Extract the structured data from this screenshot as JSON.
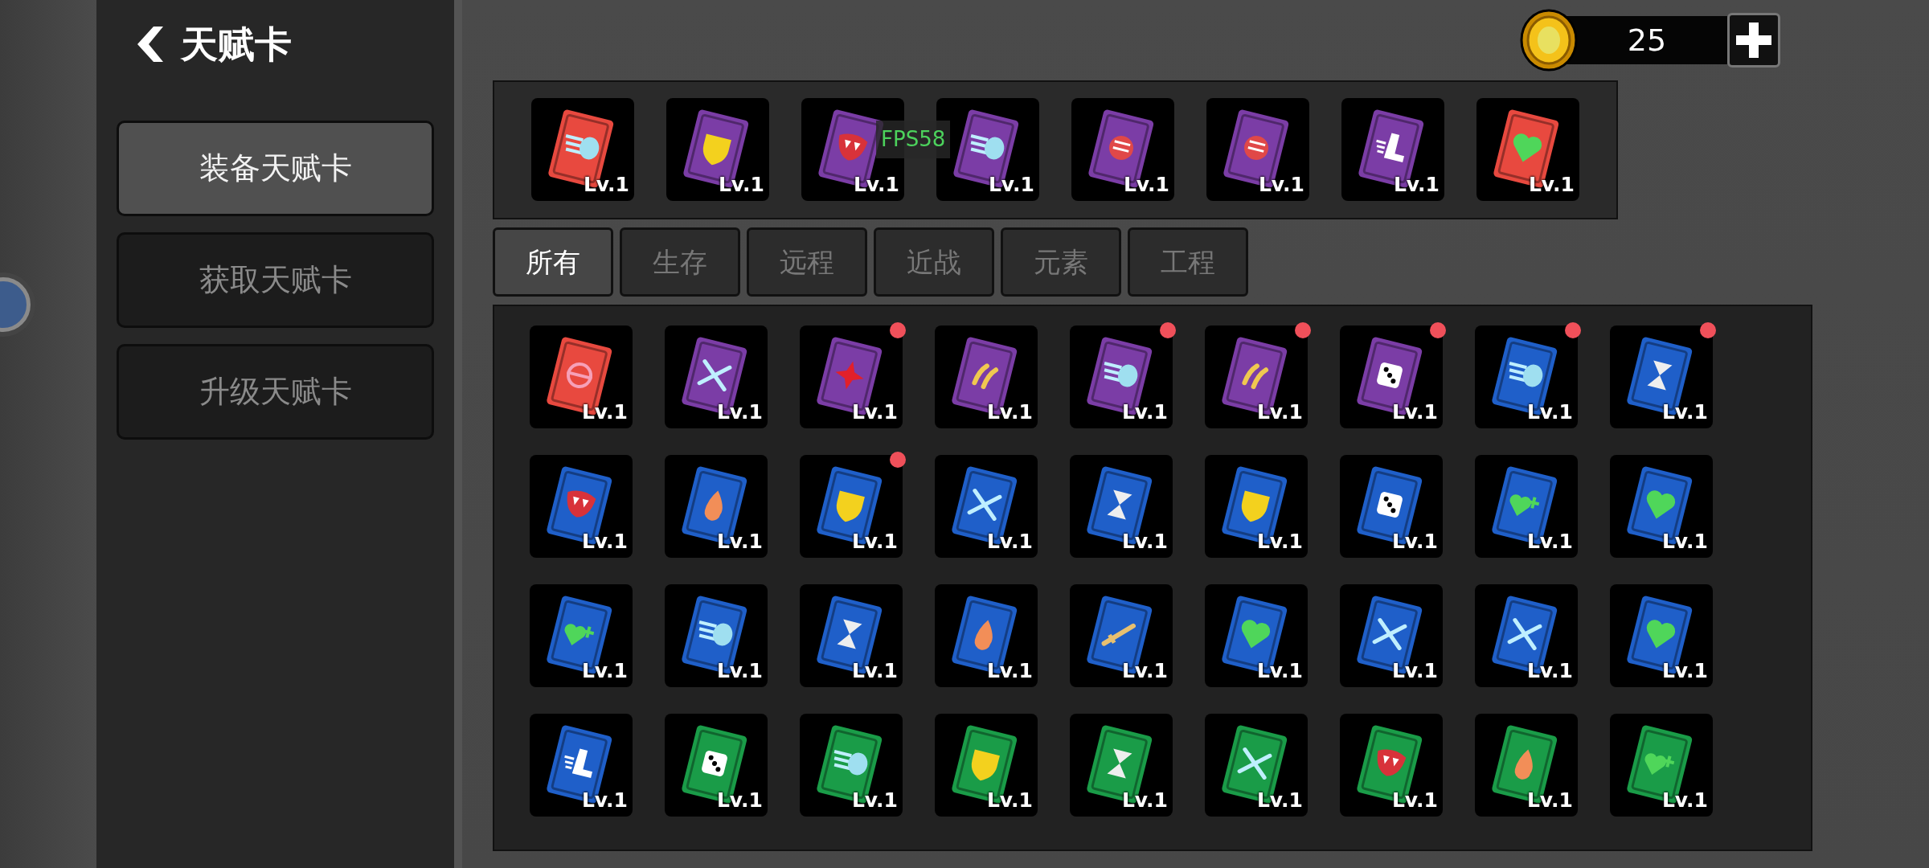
{
  "header": {
    "title": "天赋卡"
  },
  "menu": [
    {
      "label": "装备天赋卡",
      "selected": true
    },
    {
      "label": "获取天赋卡",
      "selected": false
    },
    {
      "label": "升级天赋卡",
      "selected": false
    }
  ],
  "coins": {
    "amount": "25"
  },
  "fps": "FPS58",
  "equipped": [
    {
      "color": "#e8493f",
      "kind": "wing",
      "level": "Lv.1"
    },
    {
      "color": "#7b3da6",
      "kind": "shield",
      "level": "Lv.1"
    },
    {
      "color": "#7b3da6",
      "kind": "fangs",
      "level": "Lv.1"
    },
    {
      "color": "#7b3da6",
      "kind": "wing",
      "level": "Lv.1"
    },
    {
      "color": "#7b3da6",
      "kind": "fist",
      "level": "Lv.1"
    },
    {
      "color": "#7b3da6",
      "kind": "fist",
      "level": "Lv.1"
    },
    {
      "color": "#7b3da6",
      "kind": "boot",
      "level": "Lv.1"
    },
    {
      "color": "#e8493f",
      "kind": "heart",
      "level": "Lv.1"
    }
  ],
  "tabs": [
    {
      "label": "所有",
      "selected": true
    },
    {
      "label": "生存",
      "selected": false
    },
    {
      "label": "远程",
      "selected": false
    },
    {
      "label": "近战",
      "selected": false
    },
    {
      "label": "元素",
      "selected": false
    },
    {
      "label": "工程",
      "selected": false
    }
  ],
  "cards": [
    {
      "color": "#e8493f",
      "kind": "bow",
      "level": "Lv.1",
      "notified": false
    },
    {
      "color": "#7b3da6",
      "kind": "wrench",
      "level": "Lv.1",
      "notified": false
    },
    {
      "color": "#7b3da6",
      "kind": "star",
      "level": "Lv.1",
      "notified": true
    },
    {
      "color": "#7b3da6",
      "kind": "wheat",
      "level": "Lv.1",
      "notified": false
    },
    {
      "color": "#7b3da6",
      "kind": "wing",
      "level": "Lv.1",
      "notified": true
    },
    {
      "color": "#7b3da6",
      "kind": "wheat",
      "level": "Lv.1",
      "notified": true
    },
    {
      "color": "#7b3da6",
      "kind": "dice",
      "level": "Lv.1",
      "notified": true
    },
    {
      "color": "#1f5fc9",
      "kind": "wing",
      "level": "Lv.1",
      "notified": true
    },
    {
      "color": "#1f5fc9",
      "kind": "hourglass",
      "level": "Lv.1",
      "notified": true
    },
    {
      "color": "#1f5fc9",
      "kind": "fangs",
      "level": "Lv.1",
      "notified": false
    },
    {
      "color": "#1f5fc9",
      "kind": "flame",
      "level": "Lv.1",
      "notified": false
    },
    {
      "color": "#1f5fc9",
      "kind": "shield",
      "level": "Lv.1",
      "notified": true
    },
    {
      "color": "#1f5fc9",
      "kind": "wrench",
      "level": "Lv.1",
      "notified": false
    },
    {
      "color": "#1f5fc9",
      "kind": "hourglass",
      "level": "Lv.1",
      "notified": false
    },
    {
      "color": "#1f5fc9",
      "kind": "shield",
      "level": "Lv.1",
      "notified": false
    },
    {
      "color": "#1f5fc9",
      "kind": "dice",
      "level": "Lv.1",
      "notified": false
    },
    {
      "color": "#1f5fc9",
      "kind": "heartplus",
      "level": "Lv.1",
      "notified": false
    },
    {
      "color": "#1f5fc9",
      "kind": "heart",
      "level": "Lv.1",
      "notified": false
    },
    {
      "color": "#1f5fc9",
      "kind": "heartplus",
      "level": "Lv.1",
      "notified": false
    },
    {
      "color": "#1f5fc9",
      "kind": "wing",
      "level": "Lv.1",
      "notified": false
    },
    {
      "color": "#1f5fc9",
      "kind": "hourglass",
      "level": "Lv.1",
      "notified": false
    },
    {
      "color": "#1f5fc9",
      "kind": "flame",
      "level": "Lv.1",
      "notified": false
    },
    {
      "color": "#1f5fc9",
      "kind": "sword",
      "level": "Lv.1",
      "notified": false
    },
    {
      "color": "#1f5fc9",
      "kind": "heart",
      "level": "Lv.1",
      "notified": false
    },
    {
      "color": "#1f5fc9",
      "kind": "wrench",
      "level": "Lv.1",
      "notified": false
    },
    {
      "color": "#1f5fc9",
      "kind": "wrench",
      "level": "Lv.1",
      "notified": false
    },
    {
      "color": "#1f5fc9",
      "kind": "heart",
      "level": "Lv.1",
      "notified": false
    },
    {
      "color": "#1f5fc9",
      "kind": "boot",
      "level": "Lv.1",
      "notified": false
    },
    {
      "color": "#1a9c48",
      "kind": "dice",
      "level": "Lv.1",
      "notified": false
    },
    {
      "color": "#1a9c48",
      "kind": "wing",
      "level": "Lv.1",
      "notified": false
    },
    {
      "color": "#1a9c48",
      "kind": "shield",
      "level": "Lv.1",
      "notified": false
    },
    {
      "color": "#1a9c48",
      "kind": "hourglass",
      "level": "Lv.1",
      "notified": false
    },
    {
      "color": "#1a9c48",
      "kind": "wrench",
      "level": "Lv.1",
      "notified": false
    },
    {
      "color": "#1a9c48",
      "kind": "fangs",
      "level": "Lv.1",
      "notified": false
    },
    {
      "color": "#1a9c48",
      "kind": "flame",
      "level": "Lv.1",
      "notified": false
    },
    {
      "color": "#1a9c48",
      "kind": "heartplus",
      "level": "Lv.1",
      "notified": false
    }
  ]
}
